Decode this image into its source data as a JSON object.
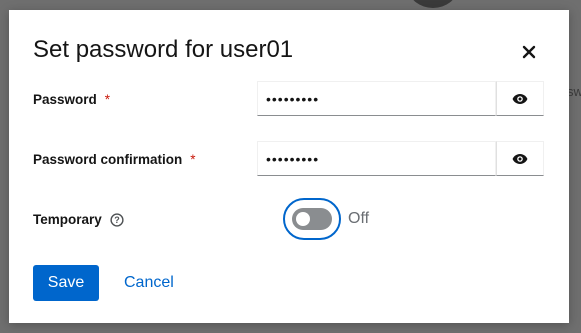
{
  "backdrop": {
    "partial_text": "sw"
  },
  "dialog": {
    "title": "Set password for user01",
    "close_icon": "close-icon"
  },
  "form": {
    "password": {
      "label": "Password",
      "required_mark": "*",
      "value": "•••••••••",
      "toggle_icon": "eye-icon"
    },
    "password_confirmation": {
      "label": "Password confirmation",
      "required_mark": "*",
      "value": "•••••••••",
      "toggle_icon": "eye-icon"
    },
    "temporary": {
      "label": "Temporary",
      "help_icon": "help-icon",
      "state_label": "Off",
      "checked": false
    }
  },
  "actions": {
    "save_label": "Save",
    "cancel_label": "Cancel"
  },
  "colors": {
    "primary": "#0066cc",
    "required": "#c9190b",
    "toggle_off": "#8a8d90",
    "text": "#151515"
  }
}
